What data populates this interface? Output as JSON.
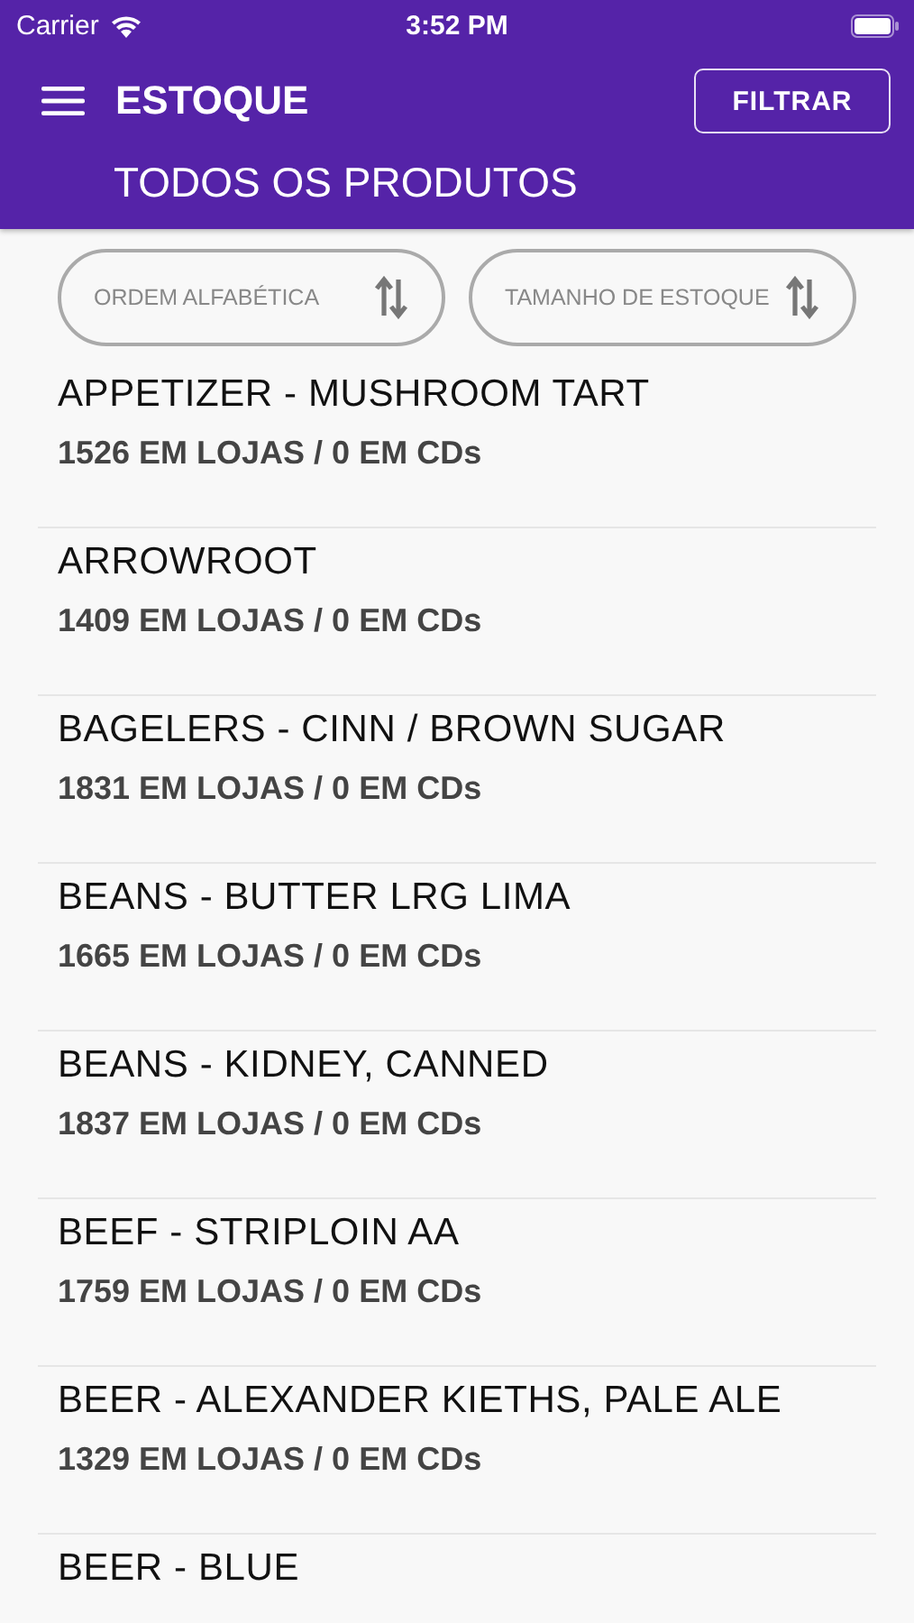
{
  "status_bar": {
    "carrier": "Carrier",
    "time": "3:52 PM"
  },
  "header": {
    "title": "ESTOQUE",
    "filter_button": "FILTRAR",
    "subtitle": "TODOS OS PRODUTOS"
  },
  "sort_buttons": [
    {
      "label": "ORDEM ALFABÉTICA"
    },
    {
      "label": "TAMANHO DE ESTOQUE"
    }
  ],
  "products": [
    {
      "name": "APPETIZER - MUSHROOM TART",
      "stock": "1526 EM LOJAS / 0 EM CDs"
    },
    {
      "name": "ARROWROOT",
      "stock": "1409 EM LOJAS / 0 EM CDs"
    },
    {
      "name": "BAGELERS - CINN / BROWN SUGAR",
      "stock": "1831 EM LOJAS / 0 EM CDs"
    },
    {
      "name": "BEANS - BUTTER LRG LIMA",
      "stock": "1665 EM LOJAS / 0 EM CDs"
    },
    {
      "name": "BEANS - KIDNEY, CANNED",
      "stock": "1837 EM LOJAS / 0 EM CDs"
    },
    {
      "name": "BEEF - STRIPLOIN AA",
      "stock": "1759 EM LOJAS / 0 EM CDs"
    },
    {
      "name": "BEER - ALEXANDER KIETHS, PALE ALE",
      "stock": "1329 EM LOJAS / 0 EM CDs"
    },
    {
      "name": "BEER - BLUE"
    }
  ]
}
